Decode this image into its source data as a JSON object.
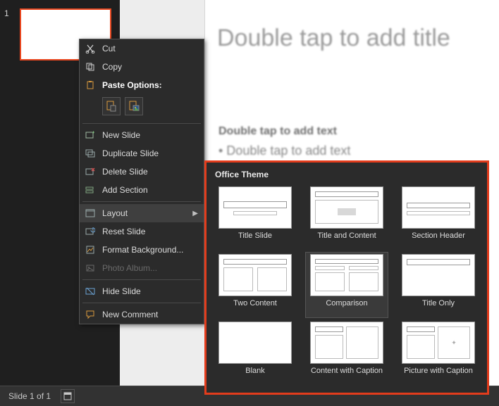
{
  "thumb_panel": {
    "slide_number": "1"
  },
  "canvas": {
    "title_placeholder": "Double tap to add title",
    "body_heading": "Double tap to add text",
    "body_bullet": "• Double tap to add text"
  },
  "status_bar": {
    "pager": "Slide 1 of 1"
  },
  "context_menu": {
    "cut": "Cut",
    "copy": "Copy",
    "paste_options": "Paste Options:",
    "new_slide": "New Slide",
    "duplicate_slide": "Duplicate Slide",
    "delete_slide": "Delete Slide",
    "add_section": "Add Section",
    "layout": "Layout",
    "reset_slide": "Reset Slide",
    "format_background": "Format Background...",
    "photo_album": "Photo Album...",
    "hide_slide": "Hide Slide",
    "new_comment": "New Comment"
  },
  "layout_flyout": {
    "header": "Office Theme",
    "items": [
      "Title Slide",
      "Title and Content",
      "Section Header",
      "Two Content",
      "Comparison",
      "Title Only",
      "Blank",
      "Content with Caption",
      "Picture with Caption"
    ],
    "selected_index": 4
  }
}
